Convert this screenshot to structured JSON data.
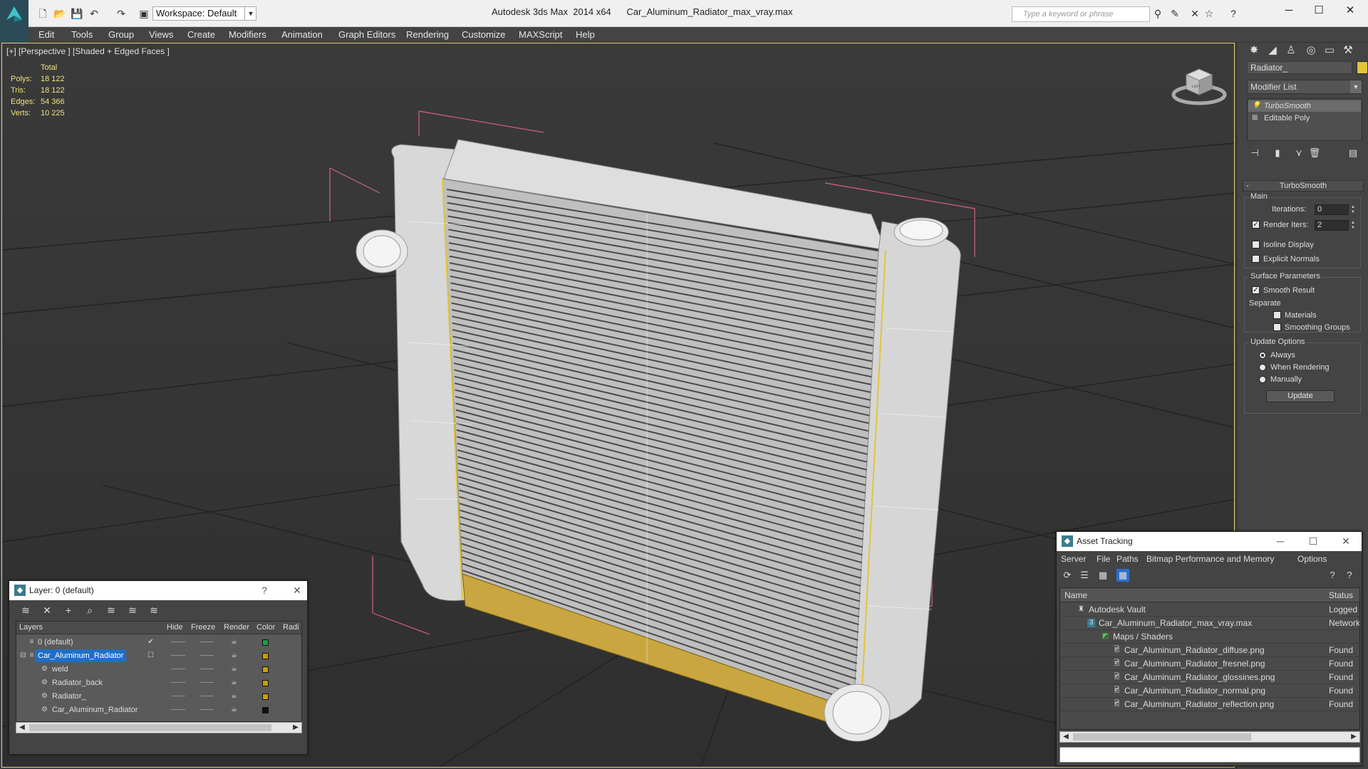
{
  "titlebar": {
    "workspace": "Workspace: Default",
    "title": "Autodesk 3ds Max  2014 x64      Car_Aluminum_Radiator_max_vray.max",
    "search_placeholder": "Type a keyword or phrase"
  },
  "menu": [
    "Edit",
    "Tools",
    "Group",
    "Views",
    "Create",
    "Modifiers",
    "Animation",
    "Graph Editors",
    "Rendering",
    "Customize",
    "MAXScript",
    "Help"
  ],
  "viewport": {
    "label": "[+] [Perspective ] [Shaded + Edged Faces ]",
    "stats": {
      "header": "Total",
      "rows": [
        {
          "k": "Polys:",
          "v": "18 122"
        },
        {
          "k": "Tris:",
          "v": "18 122"
        },
        {
          "k": "Edges:",
          "v": "54 366"
        },
        {
          "k": "Verts:",
          "v": "10 225"
        }
      ]
    },
    "viewcube_label": "LEFT"
  },
  "command_panel": {
    "object_name": "Radiator_",
    "object_color": "#e1c43a",
    "modifier_list": "Modifier List",
    "stack": [
      "TurboSmooth",
      "Editable Poly"
    ],
    "rollout": {
      "title": "TurboSmooth",
      "main_label": "Main",
      "iterations_label": "Iterations:",
      "iterations_value": "0",
      "render_iters_label": "Render Iters:",
      "render_iters_value": "2",
      "isoline": "Isoline Display",
      "explicit_normals": "Explicit Normals",
      "surface_params": "Surface Parameters",
      "smooth_result": "Smooth Result",
      "separate": "Separate",
      "materials": "Materials",
      "smoothing_groups": "Smoothing Groups",
      "update_options": "Update Options",
      "always": "Always",
      "when_rendering": "When Rendering",
      "manually": "Manually",
      "update_btn": "Update"
    }
  },
  "layers_window": {
    "title": "Layer: 0 (default)",
    "help": "?",
    "columns": [
      "Layers",
      "Hide",
      "Freeze",
      "Render",
      "Color",
      "Radi"
    ],
    "rows": [
      {
        "name": "0 (default)",
        "color": "#18a040"
      },
      {
        "name": "Car_Aluminum_Radiator",
        "color": "#c8a000"
      },
      {
        "name": "weld",
        "color": "#c8a000"
      },
      {
        "name": "Radiator_back",
        "color": "#c8a000"
      },
      {
        "name": "Radiator_",
        "color": "#c8a000"
      },
      {
        "name": "Car_Aluminum_Radiator",
        "color": "#111111"
      }
    ]
  },
  "asset_window": {
    "title": "Asset Tracking",
    "menu": [
      "Server",
      "File",
      "Paths",
      "Bitmap Performance and Memory",
      "Options"
    ],
    "columns": [
      "Name",
      "Status"
    ],
    "rows": [
      {
        "name": "Autodesk Vault",
        "status": "Logged"
      },
      {
        "name": "Car_Aluminum_Radiator_max_vray.max",
        "status": "Network"
      },
      {
        "name": "Maps / Shaders",
        "status": ""
      },
      {
        "name": "Car_Aluminum_Radiator_diffuse.png",
        "status": "Found"
      },
      {
        "name": "Car_Aluminum_Radiator_fresnel.png",
        "status": "Found"
      },
      {
        "name": "Car_Aluminum_Radiator_glossines.png",
        "status": "Found"
      },
      {
        "name": "Car_Aluminum_Radiator_normal.png",
        "status": "Found"
      },
      {
        "name": "Car_Aluminum_Radiator_reflection.png",
        "status": "Found"
      }
    ]
  }
}
